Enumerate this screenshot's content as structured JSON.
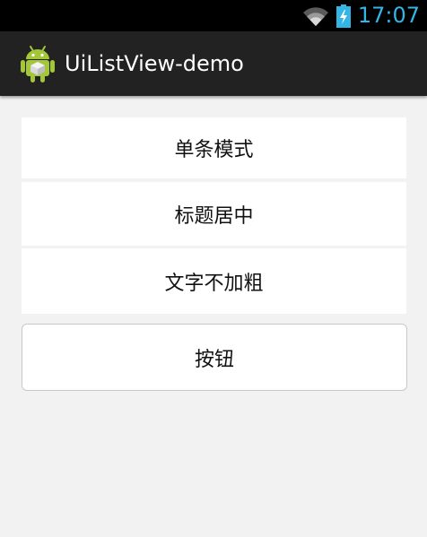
{
  "status_bar": {
    "time": "17:07",
    "wifi_icon": "wifi-icon",
    "battery_icon": "battery-charging-icon",
    "time_color": "#33b5e5"
  },
  "action_bar": {
    "app_icon": "android-icon",
    "title": "UiListView-demo",
    "background": "#222222"
  },
  "list": {
    "items": [
      {
        "label": "单条模式"
      },
      {
        "label": "标题居中"
      },
      {
        "label": "文字不加粗"
      }
    ]
  },
  "button": {
    "label": "按钮"
  }
}
